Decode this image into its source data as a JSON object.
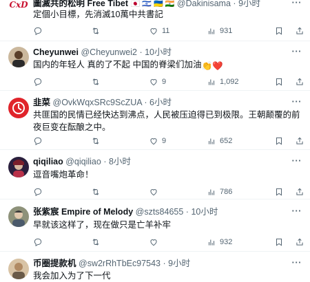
{
  "tweets": [
    {
      "name": "圖滅共的松明 Free Tibet",
      "flags": "🇯🇵 🇮🇱 🇺🇦 🇮🇳",
      "handle": "@Dakinisama",
      "dot": "·",
      "time": "9小时",
      "text": "定個小目標，先消滅10萬中共書記",
      "replies": "",
      "retweets": "",
      "likes": "11",
      "views": "931",
      "avatar_color": "#c8102e"
    },
    {
      "name": "Cheyunwei",
      "flags": "",
      "handle": "@Cheyunwei2",
      "dot": "·",
      "time": "10小时",
      "text": "国内的年轻人 真的了不起 中国的脊梁们加油",
      "text_emoji": "👏❤️",
      "replies": "",
      "retweets": "",
      "likes": "9",
      "views": "1,092",
      "avatar_color": "#8a6b4e"
    },
    {
      "name": "韭菜",
      "flags": "",
      "handle": "@OvkWqxSRc9ScZUA",
      "dot": "·",
      "time": "6小时",
      "text": "共匪国的民情已经快达到沸点，人民被压迫得已到极限。王朝颠覆的前夜巨变在酝酿之中。",
      "replies": "",
      "retweets": "",
      "likes": "9",
      "views": "652",
      "avatar_color": "#e0242b"
    },
    {
      "name": "qiqiliao",
      "flags": "",
      "handle": "@qiqiliao",
      "dot": "·",
      "time": "8小时",
      "text": "逗音嘴炮革命！",
      "replies": "",
      "retweets": "",
      "likes": "",
      "views": "786",
      "avatar_color": "#2a1f3d"
    },
    {
      "name": "张紫宸 Empire of Melody",
      "flags": "",
      "handle": "@szts84655",
      "dot": "·",
      "time": "10小时",
      "text": "早就该这样了，现在做只是亡羊补牢",
      "replies": "",
      "retweets": "",
      "likes": "",
      "views": "932",
      "avatar_color": "#6b6f5a"
    },
    {
      "name": "币圈提款机",
      "flags": "",
      "handle": "@sw2rRhTbEc97543",
      "dot": "·",
      "time": "9小时",
      "text": "我会加入为了下一代",
      "replies": "",
      "retweets": "",
      "likes": "",
      "views": "",
      "avatar_color": "#b08a63"
    }
  ],
  "more_label": "···"
}
